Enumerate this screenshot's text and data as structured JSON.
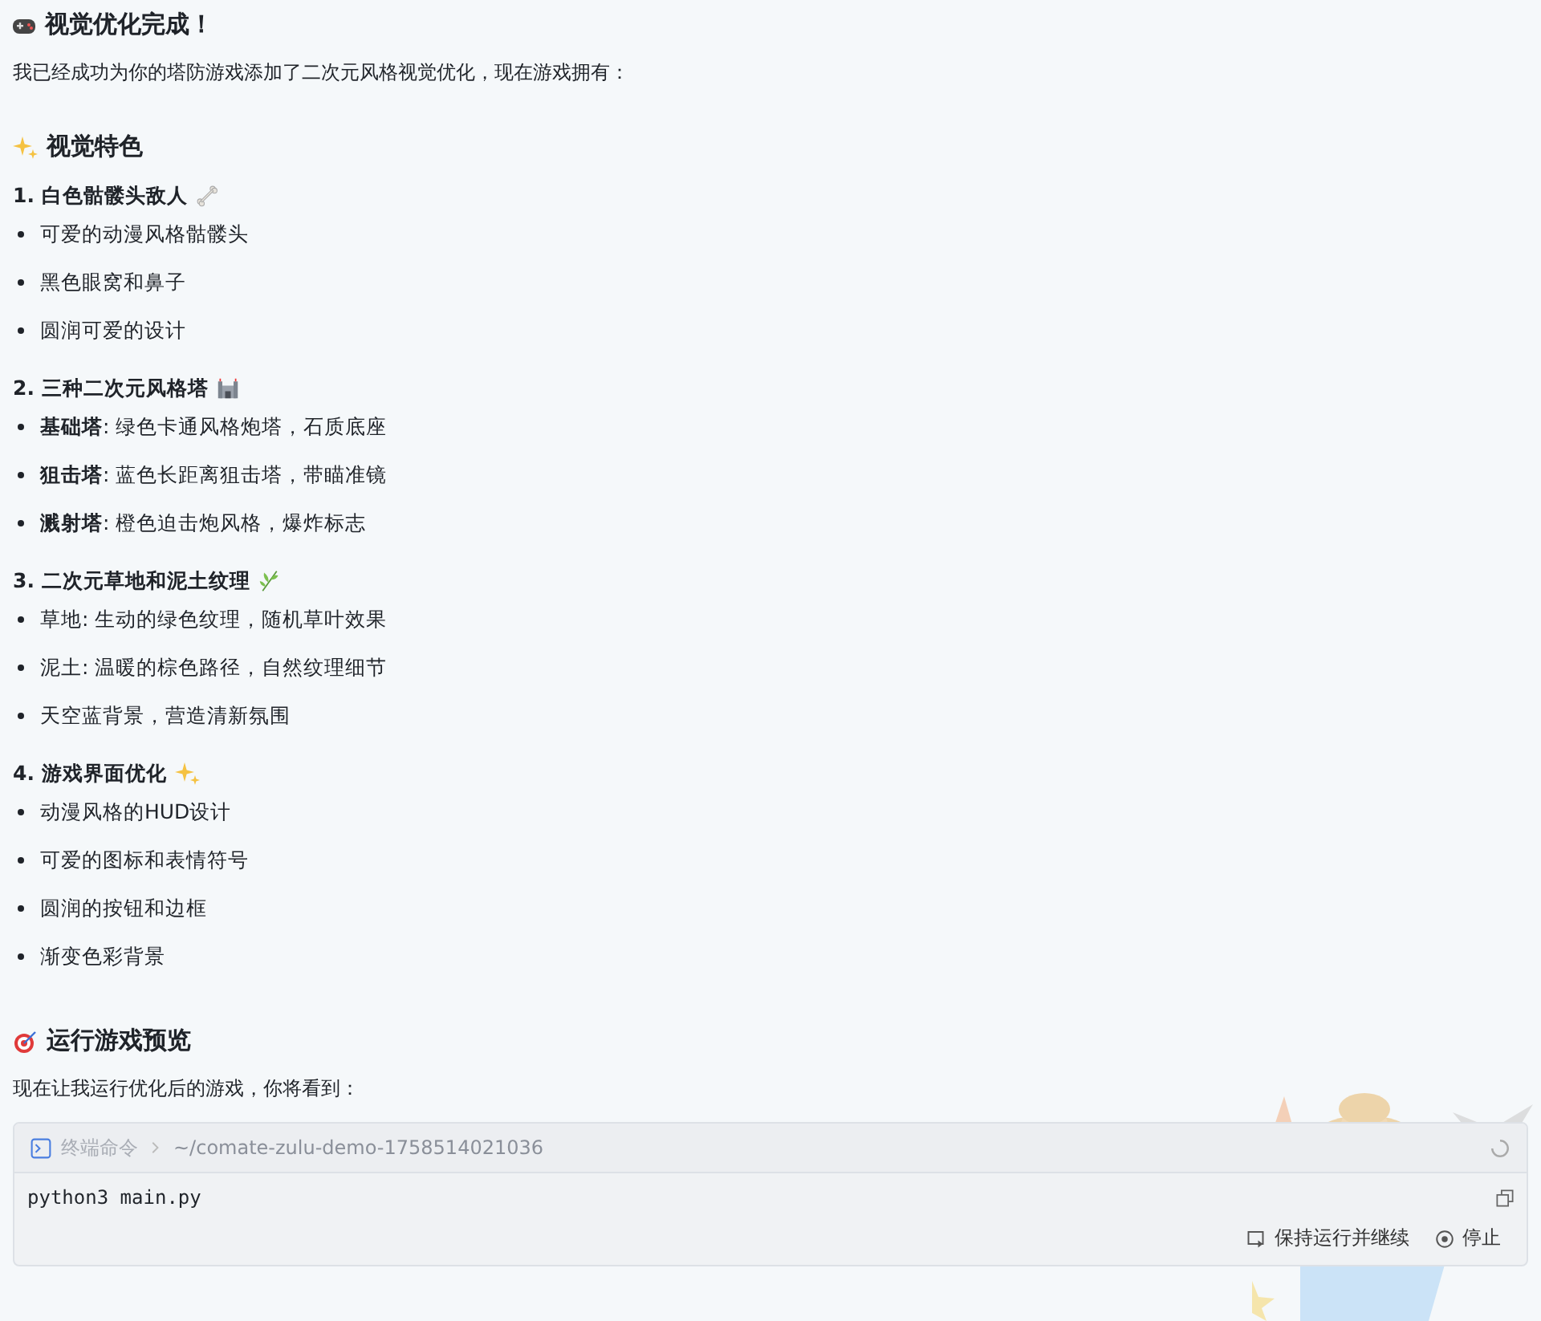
{
  "title": "视觉优化完成！",
  "intro": "我已经成功为你的塔防游戏添加了二次元风格视觉优化，现在游戏拥有：",
  "features_heading": "视觉特色",
  "sections": [
    {
      "title": "1. 白色骷髅头敌人",
      "bullets": [
        "可爱的动漫风格骷髅头",
        "黑色眼窝和鼻子",
        "圆润可爱的设计"
      ]
    },
    {
      "title": "2. 三种二次元风格塔",
      "bullets": [
        "**基础塔**: 绿色卡通风格炮塔，石质底座",
        "**狙击塔**: 蓝色长距离狙击塔，带瞄准镜",
        "**溅射塔**: 橙色迫击炮风格，爆炸标志"
      ]
    },
    {
      "title": "3. 二次元草地和泥土纹理",
      "bullets": [
        "草地: 生动的绿色纹理，随机草叶效果",
        "泥土: 温暖的棕色路径，自然纹理细节",
        "天空蓝背景，营造清新氛围"
      ]
    },
    {
      "title": "4. 游戏界面优化",
      "bullets": [
        "动漫风格的HUD设计",
        "可爱的图标和表情符号",
        "圆润的按钮和边框",
        "渐变色彩背景"
      ]
    }
  ],
  "run_heading": "运行游戏预览",
  "run_text": "现在让我运行优化后的游戏，你将看到：",
  "terminal": {
    "label": "终端命令",
    "path": "~/comate-zulu-demo-1758514021036",
    "command": "python3 main.py",
    "buttons": [
      "保持运行并继续",
      "停止"
    ]
  }
}
